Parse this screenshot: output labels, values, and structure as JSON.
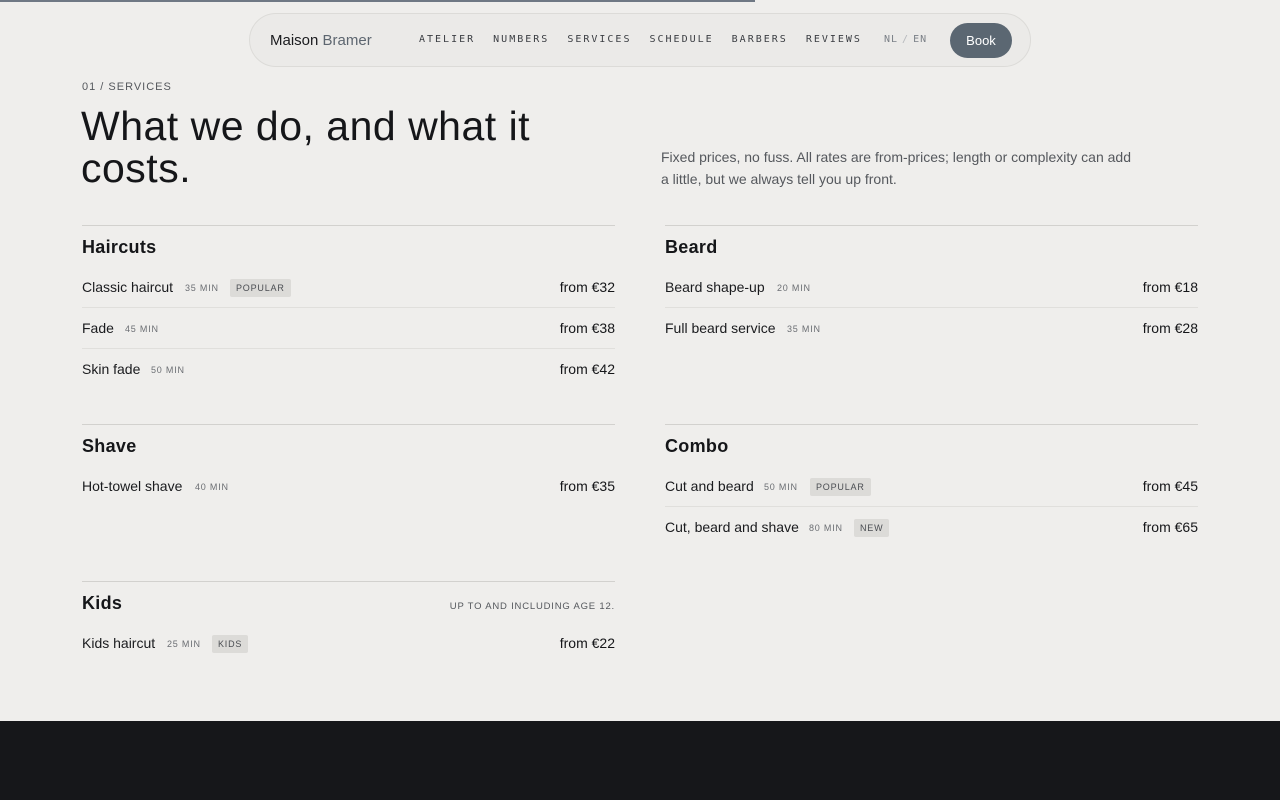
{
  "scroll_progress_percent": 59,
  "nav": {
    "brand_first": "Maison",
    "brand_second": "Bramer",
    "links": [
      "ATELIER",
      "NUMBERS",
      "SERVICES",
      "SCHEDULE",
      "BARBERS",
      "REVIEWS"
    ],
    "lang_nl": "NL",
    "lang_sep": "/",
    "lang_en": "EN",
    "book_label": "Book"
  },
  "section": {
    "eyebrow": "01 / SERVICES",
    "headline": "What we do, and what it costs.",
    "intro": "Fixed prices, no fuss. All rates are from-prices; length or complexity can add a little, but we always tell you up front."
  },
  "haircuts": {
    "title": "Haircuts",
    "items": [
      {
        "name": "Classic haircut",
        "duration": "35 MIN",
        "badge": "POPULAR",
        "price": "from €32"
      },
      {
        "name": "Fade",
        "duration": "45 MIN",
        "price": "from €38"
      },
      {
        "name": "Skin fade",
        "duration": "50 MIN",
        "price": "from €42"
      }
    ]
  },
  "beard": {
    "title": "Beard",
    "items": [
      {
        "name": "Beard shape-up",
        "duration": "20 MIN",
        "price": "from €18"
      },
      {
        "name": "Full beard service",
        "duration": "35 MIN",
        "price": "from €28"
      }
    ]
  },
  "shave": {
    "title": "Shave",
    "items": [
      {
        "name": "Hot-towel shave",
        "duration": "40 MIN",
        "price": "from €35"
      }
    ]
  },
  "combo": {
    "title": "Combo",
    "items": [
      {
        "name": "Cut and beard",
        "duration": "50 MIN",
        "badge": "POPULAR",
        "price": "from €45"
      },
      {
        "name": "Cut, beard and shave",
        "duration": "80 MIN",
        "badge": "NEW",
        "price": "from €65"
      }
    ]
  },
  "kids": {
    "title": "Kids",
    "note": "UP TO AND INCLUDING AGE 12.",
    "items": [
      {
        "name": "Kids haircut",
        "duration": "25 MIN",
        "badge": "KIDS",
        "price": "from €22"
      }
    ]
  },
  "colors": {
    "background": "#efeeec",
    "accent": "#5b6772",
    "footer": "#16171a"
  }
}
